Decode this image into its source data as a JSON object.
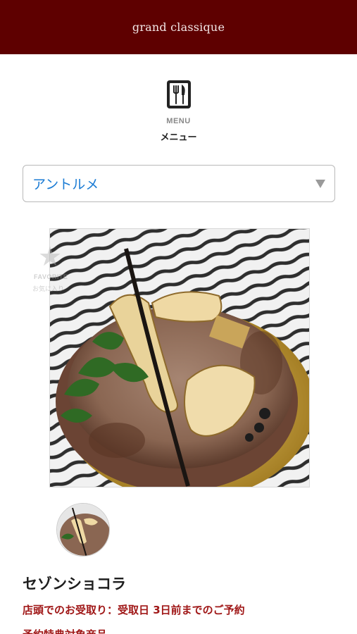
{
  "header": {
    "brand": "grand classique"
  },
  "menu": {
    "icon": "cutlery-icon",
    "label_en": "MENU",
    "label_jp": "メニュー"
  },
  "category_select": {
    "value": "アントルメ",
    "icon": "dropdown-arrow-icon"
  },
  "favorite": {
    "icon": "star-icon",
    "label_en": "FAVORITE",
    "label_jp": "お気に入り"
  },
  "product": {
    "image": "chocolate-banana-cake-photo",
    "name": "セゾンショコラ",
    "pickup_note": "店頭でのお受取り：受取日 3日前までのご予約",
    "discount_note": "予約特典対象商品"
  },
  "colors": {
    "header_bg": "#5e0000",
    "select_text": "#1a7bd4",
    "accent_red": "#a01818"
  }
}
